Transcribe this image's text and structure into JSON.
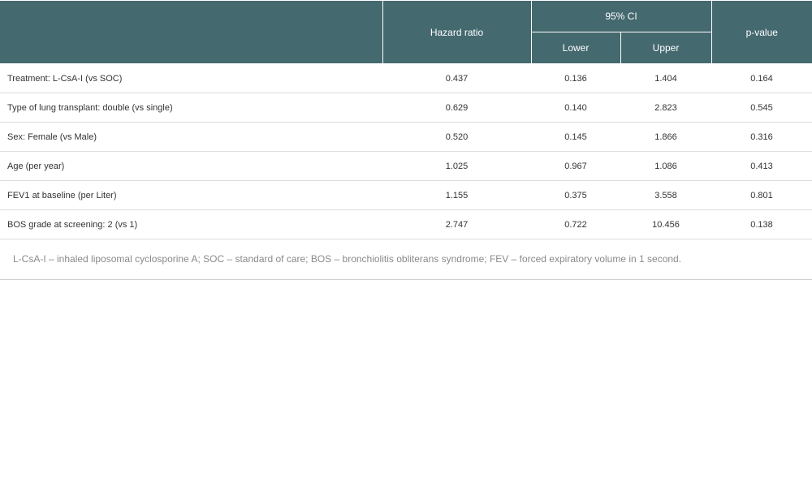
{
  "header": {
    "hazard_ratio": "Hazard ratio",
    "ci_group": "95% CI",
    "lower": "Lower",
    "upper": "Upper",
    "p_value": "p-value"
  },
  "rows": [
    {
      "label": "Treatment: L-CsA-I (vs SOC)",
      "hr": "0.437",
      "lower": "0.136",
      "upper": "1.404",
      "p": "0.164"
    },
    {
      "label": "Type of lung transplant: double (vs single)",
      "hr": "0.629",
      "lower": "0.140",
      "upper": "2.823",
      "p": "0.545"
    },
    {
      "label": "Sex: Female (vs Male)",
      "hr": "0.520",
      "lower": "0.145",
      "upper": "1.866",
      "p": "0.316"
    },
    {
      "label": "Age (per year)",
      "hr": "1.025",
      "lower": "0.967",
      "upper": "1.086",
      "p": "0.413"
    },
    {
      "label": "FEV1 at baseline (per Liter)",
      "hr": "1.155",
      "lower": "0.375",
      "upper": "3.558",
      "p": "0.801"
    },
    {
      "label": "BOS grade at screening: 2 (vs 1)",
      "hr": "2.747",
      "lower": "0.722",
      "upper": "10.456",
      "p": "0.138"
    }
  ],
  "footnote": "L-CsA-I – inhaled liposomal cyclosporine A; SOC – standard of care; BOS – bronchiolitis obliterans syndrome; FEV – forced expiratory volume in 1 second.",
  "colors": {
    "header_bg": "#44696f",
    "header_text": "#ffffff",
    "row_divider": "#dddddd",
    "footnote_text": "#8a8a8a"
  }
}
